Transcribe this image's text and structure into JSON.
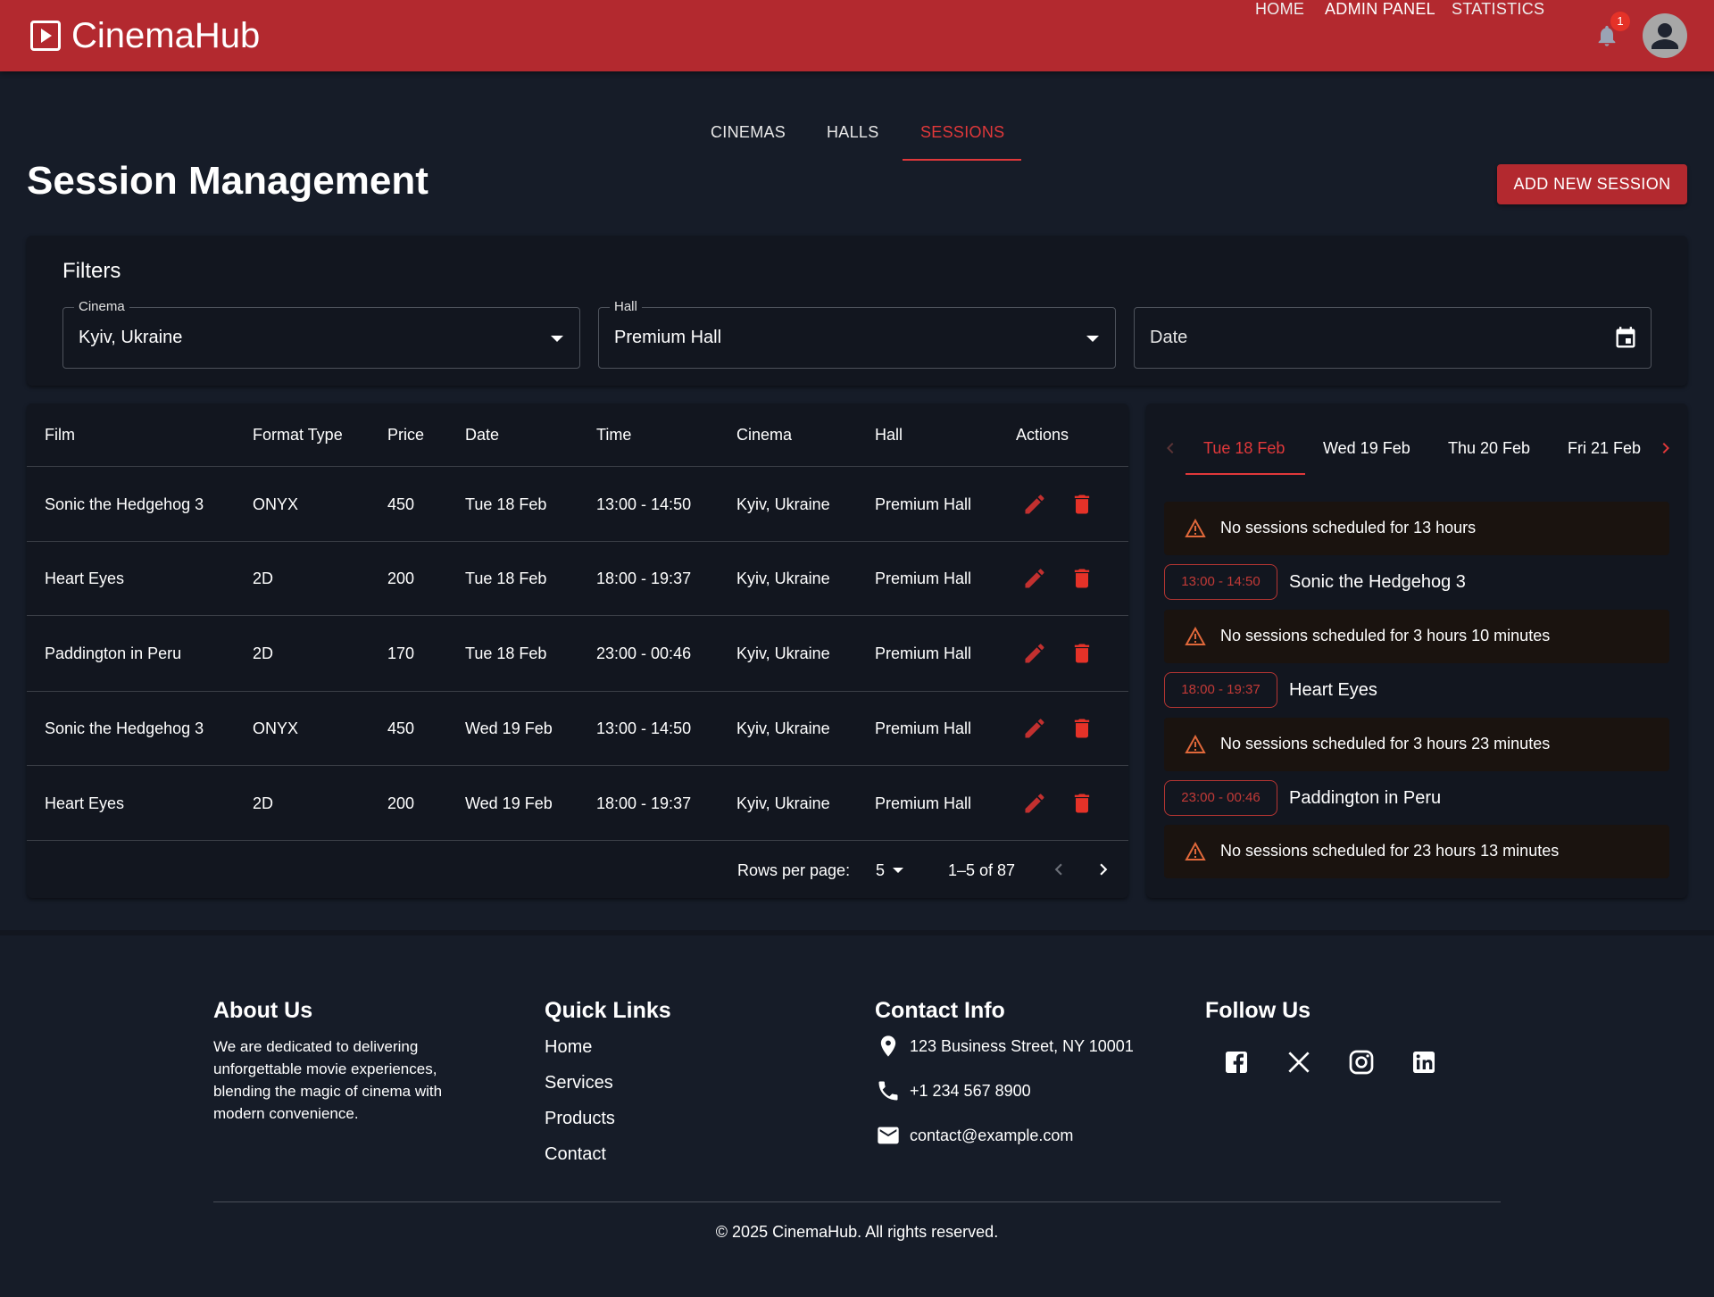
{
  "app": {
    "name": "CinemaHub"
  },
  "nav": {
    "home": "HOME",
    "admin": "ADMIN PANEL",
    "stats": "STATISTICS",
    "notification_count": "1"
  },
  "tabs": {
    "cinemas": "CINEMAS",
    "halls": "HALLS",
    "sessions": "SESSIONS",
    "active": "SESSIONS"
  },
  "page": {
    "title": "Session Management",
    "add_button": "ADD NEW SESSION"
  },
  "filters": {
    "title": "Filters",
    "cinema_label": "Cinema",
    "cinema_value": "Kyiv, Ukraine",
    "hall_label": "Hall",
    "hall_value": "Premium Hall",
    "date_placeholder": "Date"
  },
  "table": {
    "headers": [
      "Film",
      "Format Type",
      "Price",
      "Date",
      "Time",
      "Cinema",
      "Hall",
      "Actions"
    ],
    "rows": [
      [
        "Sonic the Hedgehog 3",
        "ONYX",
        "450",
        "Tue 18 Feb",
        "13:00 - 14:50",
        "Kyiv, Ukraine",
        "Premium Hall"
      ],
      [
        "Heart Eyes",
        "2D",
        "200",
        "Tue 18 Feb",
        "18:00 - 19:37",
        "Kyiv, Ukraine",
        "Premium Hall"
      ],
      [
        "Paddington in Peru",
        "2D",
        "170",
        "Tue 18 Feb",
        "23:00 - 00:46",
        "Kyiv, Ukraine",
        "Premium Hall"
      ],
      [
        "Sonic the Hedgehog 3",
        "ONYX",
        "450",
        "Wed 19 Feb",
        "13:00 - 14:50",
        "Kyiv, Ukraine",
        "Premium Hall"
      ],
      [
        "Heart Eyes",
        "2D",
        "200",
        "Wed 19 Feb",
        "18:00 - 19:37",
        "Kyiv, Ukraine",
        "Premium Hall"
      ]
    ],
    "rows_per_page_label": "Rows per page:",
    "rows_per_page": "5",
    "range": "1–5 of 87"
  },
  "schedule": {
    "days": [
      "Tue 18 Feb",
      "Wed 19 Feb",
      "Thu 20 Feb",
      "Fri 21 Feb"
    ],
    "active_day": "Tue 18 Feb",
    "gaps": [
      "No sessions scheduled for 13 hours",
      "No sessions scheduled for 3 hours 10 minutes",
      "No sessions scheduled for 3 hours 23 minutes",
      "No sessions scheduled for 23 hours 13 minutes"
    ],
    "slots": [
      {
        "time": "13:00 - 14:50",
        "film": "Sonic the Hedgehog 3"
      },
      {
        "time": "18:00 - 19:37",
        "film": "Heart Eyes"
      },
      {
        "time": "23:00 - 00:46",
        "film": "Paddington in Peru"
      }
    ]
  },
  "footer": {
    "about_title": "About Us",
    "about_text": "We are dedicated to delivering unforgettable movie experiences, blending the magic of cinema with modern convenience.",
    "links_title": "Quick Links",
    "links": [
      "Home",
      "Services",
      "Products",
      "Contact"
    ],
    "contact_title": "Contact Info",
    "address": "123 Business Street, NY 10001",
    "phone": "+1 234 567 8900",
    "email": "contact@example.com",
    "follow_title": "Follow Us",
    "socials": [
      "facebook-icon",
      "x-icon",
      "instagram-icon",
      "linkedin-icon"
    ],
    "copyright": "© 2025 CinemaHub. All rights reserved."
  },
  "colors": {
    "brand": "#b3292f",
    "accent": "#e0383a",
    "background": "#161c28",
    "panel": "#12161f",
    "delete": "#e53228"
  }
}
